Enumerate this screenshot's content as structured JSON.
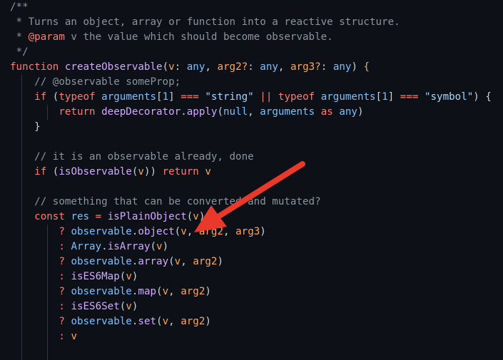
{
  "code": {
    "lines": [
      [
        "/**"
      ],
      [
        " * Turns an object, array or function into a reactive structure."
      ],
      [
        " * ",
        "@param",
        " v the value which should become observable."
      ],
      [
        " */"
      ],
      [
        "function",
        " ",
        "createObservable",
        "(",
        "v",
        ": ",
        "any",
        ", ",
        "arg2?",
        ": ",
        "any",
        ", ",
        "arg3?",
        ": ",
        "any",
        ") ",
        "{"
      ],
      [
        "    ",
        "// @observable someProp;"
      ],
      [
        "    ",
        "if",
        " (",
        "typeof",
        " ",
        "arguments",
        "[",
        "1",
        "] ",
        "===",
        " ",
        "\"string\"",
        " ",
        "||",
        " ",
        "typeof",
        " ",
        "arguments",
        "[",
        "1",
        "] ",
        "===",
        " ",
        "\"symbol\"",
        ") {"
      ],
      [
        "        ",
        "return",
        " ",
        "deepDecorator",
        ".",
        "apply",
        "(",
        "null",
        ", ",
        "arguments",
        " ",
        "as",
        " ",
        "any",
        ")"
      ],
      [
        "    ",
        "}"
      ],
      [
        ""
      ],
      [
        "    ",
        "// it is an observable already, done"
      ],
      [
        "    ",
        "if",
        " (",
        "isObservable",
        "(",
        "v",
        ")) ",
        "return",
        " ",
        "v"
      ],
      [
        ""
      ],
      [
        "    ",
        "// something that can be converted and mutated?"
      ],
      [
        "    ",
        "const",
        " ",
        "res",
        " ",
        "=",
        " ",
        "isPlainObject",
        "(",
        "v",
        ")"
      ],
      [
        "        ",
        "?",
        " ",
        "observable",
        ".",
        "object",
        "(",
        "v",
        ", ",
        "arg2",
        ", ",
        "arg3",
        ")"
      ],
      [
        "        ",
        ":",
        " ",
        "Array",
        ".",
        "isArray",
        "(",
        "v",
        ")"
      ],
      [
        "        ",
        "?",
        " ",
        "observable",
        ".",
        "array",
        "(",
        "v",
        ", ",
        "arg2",
        ")"
      ],
      [
        "        ",
        ":",
        " ",
        "isES6Map",
        "(",
        "v",
        ")"
      ],
      [
        "        ",
        "?",
        " ",
        "observable",
        ".",
        "map",
        "(",
        "v",
        ", ",
        "arg2",
        ")"
      ],
      [
        "        ",
        ":",
        " ",
        "isES6Set",
        "(",
        "v",
        ")"
      ],
      [
        "        ",
        "?",
        " ",
        "observable",
        ".",
        "set",
        "(",
        "v",
        ", ",
        "arg2",
        ")"
      ],
      [
        "        ",
        ":",
        " ",
        "v"
      ]
    ],
    "classes": [
      [
        "comment"
      ],
      [
        "comment"
      ],
      [
        "comment",
        "kw",
        "comment"
      ],
      [
        "comment"
      ],
      [
        "kw",
        "plain",
        "fn",
        "plain",
        "param",
        "plain",
        "var",
        "plain",
        "param",
        "plain",
        "var",
        "plain",
        "param",
        "plain",
        "var",
        "plain",
        "brace"
      ],
      [
        "plain",
        "comment"
      ],
      [
        "plain",
        "kw",
        "plain",
        "kw",
        "plain",
        "var",
        "plain",
        "num",
        "plain",
        "op",
        "plain",
        "str",
        "plain",
        "op",
        "plain",
        "kw",
        "plain",
        "var",
        "plain",
        "num",
        "plain",
        "op",
        "plain",
        "str",
        "plain"
      ],
      [
        "plain",
        "kw",
        "plain",
        "fn",
        "plain",
        "fn",
        "plain",
        "var",
        "plain",
        "var",
        "plain",
        "kw",
        "plain",
        "var",
        "plain"
      ],
      [
        "plain",
        "plain"
      ],
      [
        "plain"
      ],
      [
        "plain",
        "comment"
      ],
      [
        "plain",
        "kw",
        "plain",
        "fn",
        "plain",
        "param",
        "plain",
        "kw",
        "plain",
        "param"
      ],
      [
        "plain"
      ],
      [
        "plain",
        "comment"
      ],
      [
        "plain",
        "kw",
        "plain",
        "var",
        "plain",
        "op",
        "plain",
        "fn",
        "plain",
        "param",
        "plain"
      ],
      [
        "plain",
        "op",
        "plain",
        "var",
        "plain",
        "fn",
        "plain",
        "param",
        "plain",
        "param",
        "plain",
        "param",
        "plain"
      ],
      [
        "plain",
        "op",
        "plain",
        "var",
        "plain",
        "fn",
        "plain",
        "param",
        "plain"
      ],
      [
        "plain",
        "op",
        "plain",
        "var",
        "plain",
        "fn",
        "plain",
        "param",
        "plain",
        "param",
        "plain"
      ],
      [
        "plain",
        "op",
        "plain",
        "fn",
        "plain",
        "param",
        "plain"
      ],
      [
        "plain",
        "op",
        "plain",
        "var",
        "plain",
        "fn",
        "plain",
        "param",
        "plain",
        "param",
        "plain"
      ],
      [
        "plain",
        "op",
        "plain",
        "fn",
        "plain",
        "param",
        "plain"
      ],
      [
        "plain",
        "op",
        "plain",
        "var",
        "plain",
        "fn",
        "plain",
        "param",
        "plain",
        "param",
        "plain"
      ],
      [
        "plain",
        "op",
        "plain",
        "param"
      ]
    ]
  },
  "annotation": {
    "arrow_color": "#e8392a"
  }
}
